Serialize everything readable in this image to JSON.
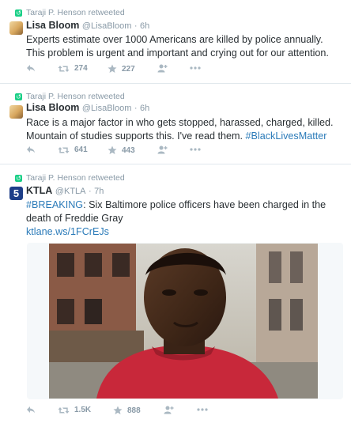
{
  "tweets": [
    {
      "retweeter": "Taraji P. Henson retweeted",
      "name": "Lisa Bloom",
      "handle": "@LisaBloom",
      "time": "6h",
      "text": "Experts estimate over 1000 Americans are killed by police annually. This problem is urgent and important and crying out for our attention.",
      "retweets": "274",
      "favorites": "227"
    },
    {
      "retweeter": "Taraji P. Henson retweeted",
      "name": "Lisa Bloom",
      "handle": "@LisaBloom",
      "time": "6h",
      "text": "Race is a major factor in who gets stopped, harassed, charged, killed. Mountain of studies supports this. I've read them.",
      "hashtag": "#BlackLivesMatter",
      "retweets": "641",
      "favorites": "443"
    },
    {
      "retweeter": "Taraji P. Henson retweeted",
      "name": "KTLA",
      "handle": "@KTLA",
      "time": "7h",
      "hashtag": "#BREAKING",
      "text": ": Six Baltimore police officers have been charged in the death of Freddie Gray",
      "link": "ktlane.ws/1FCrEJs",
      "retweets": "1.5K",
      "favorites": "888"
    }
  ],
  "avatar_ktla_label": "5",
  "dot": "·",
  "icons": [
    "retweet-icon",
    "reply-icon",
    "favorite-icon",
    "follow-icon",
    "more-icon"
  ],
  "colors": {
    "link": "#2b7bb9",
    "muted": "#8899a6",
    "retweet_green": "#19cf86"
  }
}
